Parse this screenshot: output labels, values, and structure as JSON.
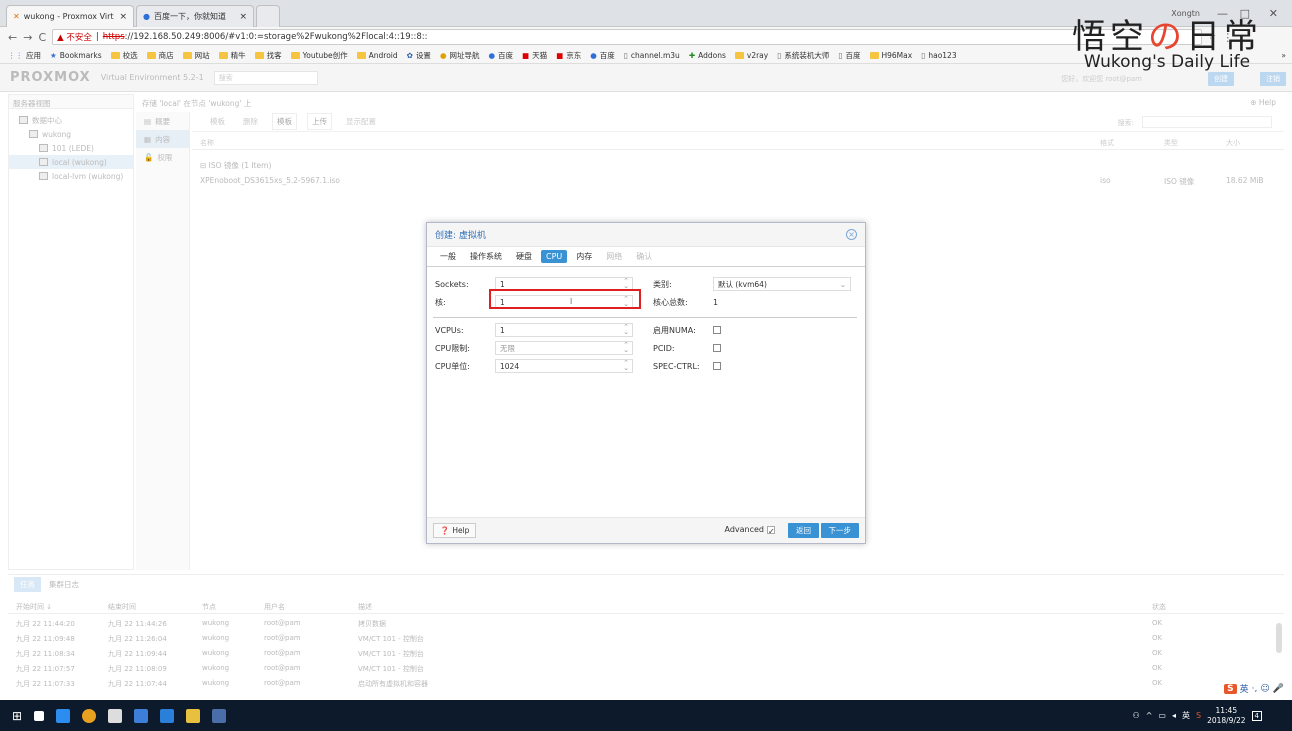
{
  "browser": {
    "tabs": [
      {
        "title": "wukong - Proxmox Virt",
        "close": "×"
      },
      {
        "title": "百度一下，你就知道",
        "close": "×"
      }
    ],
    "window_user": "Xongtn",
    "min": "—",
    "max": "□",
    "close": "✕",
    "back": "←",
    "forward": "→",
    "reload": "C",
    "insecure_label": "▲ 不安全",
    "url_https": "https",
    "url_rest": "://192.168.50.249:8006/#v1:0:=storage%2Fwukong%2Flocal:4::19::8::",
    "bookmarks": [
      "应用",
      "Bookmarks",
      "校选",
      "商店",
      "网站",
      "精牛",
      "找客",
      "Youtube创作",
      "Android",
      "设置",
      "网址导航",
      "百度",
      "天猫",
      "京东",
      "百度",
      "channel.m3u",
      "Addons",
      "v2ray",
      "系统装机大师",
      "百度",
      "H96Max",
      "hao123"
    ],
    "more": "»"
  },
  "overlay": {
    "cn_a": "悟空",
    "cn_o": "の",
    "cn_b": "日常",
    "en": "Wukong's Daily Life"
  },
  "pve": {
    "logo": "PROXMOX",
    "version": "Virtual Environment 5.2-1",
    "search_placeholder": "搜索",
    "user_text": "您好，欢迎您 root@pam",
    "btn_create": "创建",
    "btn_logout": "注销",
    "server_view": "服务器视图",
    "tree": [
      "数据中心",
      "wukong",
      "101 (LEDE)",
      "local (wukong)",
      "local-lvm (wukong)"
    ],
    "breadcrumb": "存储 'local' 在节点 'wukong' 上",
    "help": "Help",
    "subnav": [
      "概要",
      "内容",
      "权限"
    ],
    "toolbar": [
      "模板",
      "删除",
      "模板",
      "上传",
      "显示配置"
    ],
    "search_label": "搜索:",
    "col_name": "名称",
    "col_format": "格式",
    "col_type": "类型",
    "col_size": "大小",
    "group_row": "ISO 镜像 (1 Item)",
    "file_name": "XPEnoboot_DS3615xs_5.2-5967.1.iso",
    "file_format": "iso",
    "file_type": "ISO 镜像",
    "file_size": "18.62 MiB"
  },
  "dialog": {
    "title": "创建: 虚拟机",
    "close_icon": "⊗",
    "tabs": [
      {
        "label": "一般",
        "state": "normal"
      },
      {
        "label": "操作系统",
        "state": "normal"
      },
      {
        "label": "硬盘",
        "state": "normal"
      },
      {
        "label": "CPU",
        "state": "active"
      },
      {
        "label": "内存",
        "state": "normal"
      },
      {
        "label": "网络",
        "state": "disabled"
      },
      {
        "label": "确认",
        "state": "disabled"
      }
    ],
    "sockets_label": "Sockets:",
    "sockets_value": "1",
    "cores_label": "核:",
    "cores_value": "1",
    "type_label": "类别:",
    "type_value": "默认 (kvm64)",
    "total_cores_label": "核心总数:",
    "total_cores_value": "1",
    "vcpus_label": "VCPUs:",
    "vcpus_value": "1",
    "cpulimit_label": "CPU限制:",
    "cpulimit_value": "无限",
    "cpuunits_label": "CPU单位:",
    "cpuunits_value": "1024",
    "numa_label": "启用NUMA:",
    "pcid_label": "PCID:",
    "specctrl_label": "SPEC-CTRL:",
    "help_label": "Help",
    "advanced_label": "Advanced",
    "back_label": "返回",
    "next_label": "下一步"
  },
  "tasks": {
    "tabs": [
      "任务",
      "集群日志"
    ],
    "headers": [
      "开始时间 ↓",
      "结束时间",
      "节点",
      "用户名",
      "描述",
      "状态"
    ],
    "rows": [
      [
        "九月 22 11:44:20",
        "九月 22 11:44:26",
        "wukong",
        "root@pam",
        "拷贝数据",
        "OK"
      ],
      [
        "九月 22 11:09:48",
        "九月 22 11:26:04",
        "wukong",
        "root@pam",
        "VM/CT 101 - 控制台",
        "OK"
      ],
      [
        "九月 22 11:08:34",
        "九月 22 11:09:44",
        "wukong",
        "root@pam",
        "VM/CT 101 - 控制台",
        "OK"
      ],
      [
        "九月 22 11:07:57",
        "九月 22 11:08:09",
        "wukong",
        "root@pam",
        "VM/CT 101 - 控制台",
        "OK"
      ],
      [
        "九月 22 11:07:33",
        "九月 22 11:07:44",
        "wukong",
        "root@pam",
        "启动所有虚拟机和容器",
        "OK"
      ]
    ]
  },
  "taskbar": {
    "time": "11:45",
    "date": "2018/9/22",
    "ime": "英",
    "lang": "英",
    "notif": "4"
  },
  "colors": {
    "accent": "#3892d4",
    "highlight": "#e02020",
    "taskbar": "#0c1a2c"
  }
}
